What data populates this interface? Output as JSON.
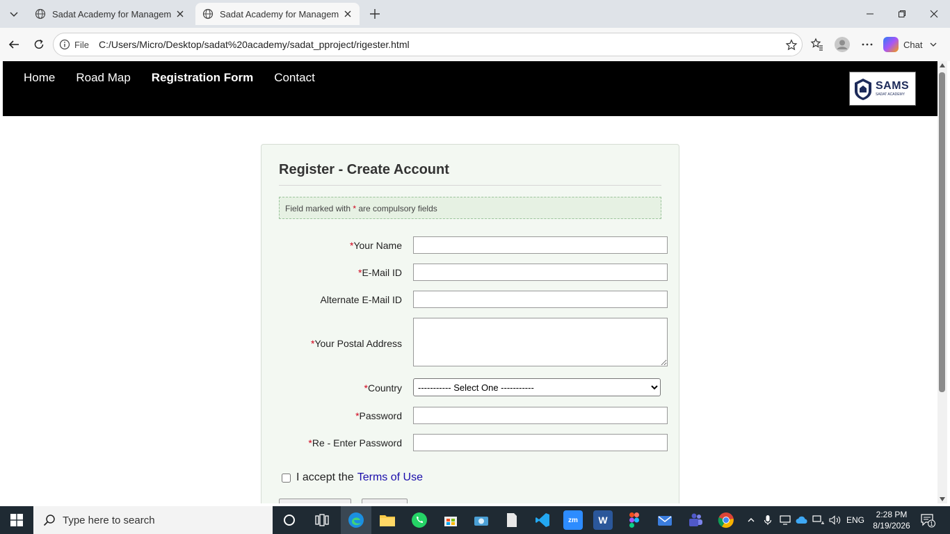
{
  "browser": {
    "tabs": [
      {
        "title": "Sadat Academy for Management S",
        "active": false
      },
      {
        "title": "Sadat Academy for Management S",
        "active": true
      }
    ],
    "address": {
      "scheme": "File",
      "url": "C:/Users/Micro/Desktop/sadat%20academy/sadat_pproject/rigester.html"
    },
    "chat_label": "Chat"
  },
  "site": {
    "nav": [
      {
        "label": "Home"
      },
      {
        "label": "Road Map"
      },
      {
        "label": "Registration Form"
      },
      {
        "label": "Contact"
      }
    ],
    "logo": {
      "big": "SAMS",
      "small": "SADAT ACADEMY"
    }
  },
  "form": {
    "title": "Register - Create Account",
    "notice": {
      "before": "Field marked with ",
      "star": "*",
      "after": " are compulsory fields"
    },
    "fields": [
      {
        "label": "Your Name",
        "required": true,
        "value": ""
      },
      {
        "label": "E-Mail ID",
        "required": true,
        "value": ""
      },
      {
        "label": "Alternate E-Mail ID",
        "required": false,
        "value": ""
      },
      {
        "label": "Your Postal Address",
        "required": true,
        "value": ""
      },
      {
        "label": "Country",
        "required": true,
        "value": "----------- Select One -----------"
      },
      {
        "label": "Password",
        "required": true,
        "value": ""
      },
      {
        "label": "Re - Enter Password",
        "required": true,
        "value": ""
      }
    ],
    "terms": {
      "before": "I accept the",
      "link": "Terms of Use"
    }
  },
  "taskbar": {
    "search_placeholder": "Type here to search",
    "language": "ENG",
    "time": "2:28 PM",
    "date": "8/19/2026",
    "notification_count": "1"
  },
  "colors": {
    "header_bg": "#000000",
    "form_bg": "#f3f8f2",
    "required_star": "#d0021b",
    "link": "#1a0dab"
  }
}
